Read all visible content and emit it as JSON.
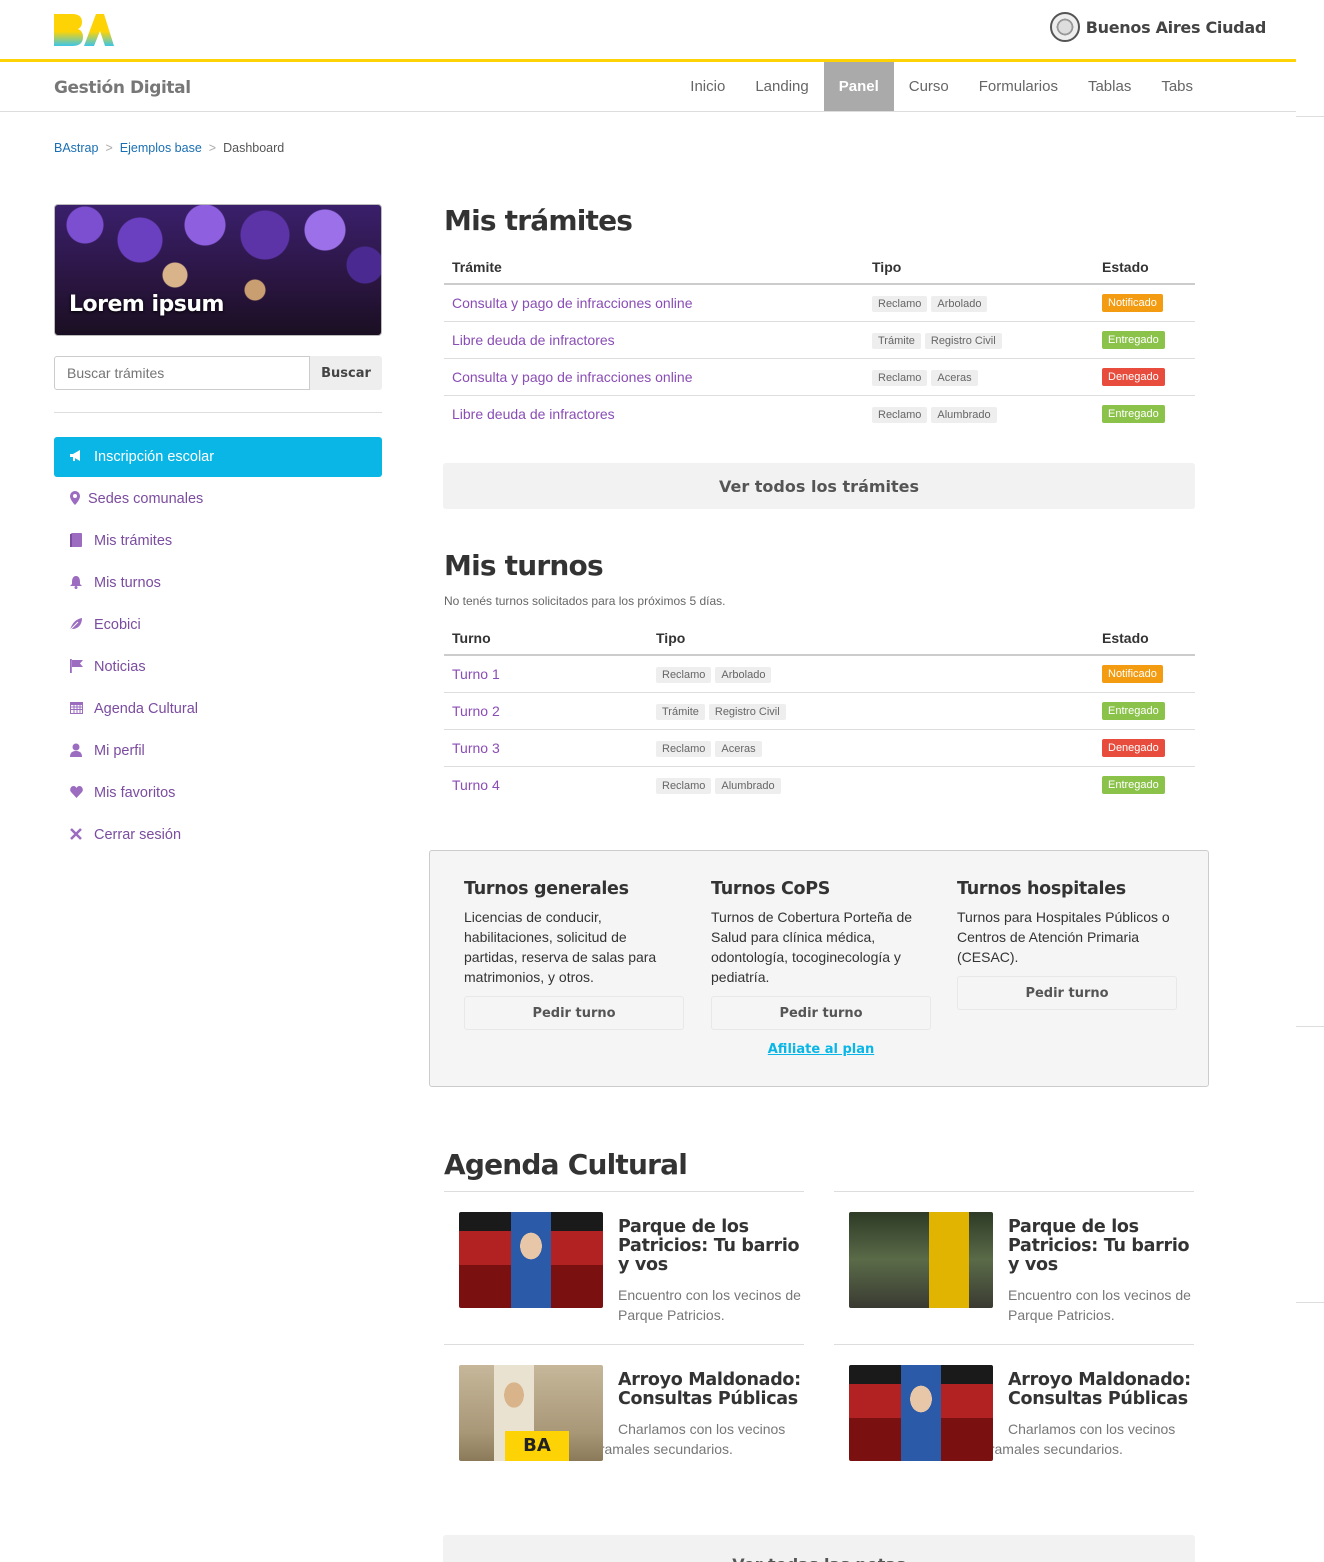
{
  "header": {
    "city_name": "Buenos Aires Ciudad",
    "brand": "Gestión Digital",
    "nav": [
      {
        "label": "Inicio",
        "active": false
      },
      {
        "label": "Landing",
        "active": false
      },
      {
        "label": "Panel",
        "active": true
      },
      {
        "label": "Curso",
        "active": false
      },
      {
        "label": "Formularios",
        "active": false
      },
      {
        "label": "Tablas",
        "active": false
      },
      {
        "label": "Tabs",
        "active": false
      }
    ]
  },
  "breadcrumb": [
    "BAstrap",
    "Ejemplos base",
    "Dashboard"
  ],
  "sidebar": {
    "promo_title": "Lorem ipsum",
    "search_placeholder": "Buscar trámites",
    "search_button": "Buscar",
    "menu": [
      {
        "label": "Inscripción escolar",
        "icon": "megaphone-icon",
        "active": true
      },
      {
        "label": "Sedes comunales",
        "icon": "map-marker-icon"
      },
      {
        "label": "Mis trámites",
        "icon": "book-icon"
      },
      {
        "label": "Mis turnos",
        "icon": "bell-icon"
      },
      {
        "label": "Ecobici",
        "icon": "leaf-icon"
      },
      {
        "label": "Noticias",
        "icon": "flag-icon"
      },
      {
        "label": "Agenda Cultural",
        "icon": "calendar-icon"
      },
      {
        "label": "Mi perfil",
        "icon": "user-icon"
      },
      {
        "label": "Mis favoritos",
        "icon": "heart-icon"
      },
      {
        "label": "Cerrar sesión",
        "icon": "close-icon"
      }
    ]
  },
  "tramites": {
    "title": "Mis trámites",
    "columns": [
      "Trámite",
      "Tipo",
      "Estado"
    ],
    "rows": [
      {
        "name": "Consulta y pago de infracciones online",
        "tags": [
          "Reclamo",
          "Arbolado"
        ],
        "status": "Notificado"
      },
      {
        "name": "Libre deuda de infractores",
        "tags": [
          "Trámite",
          "Registro Civil"
        ],
        "status": "Entregado"
      },
      {
        "name": "Consulta y pago de infracciones online",
        "tags": [
          "Reclamo",
          "Aceras"
        ],
        "status": "Denegado"
      },
      {
        "name": "Libre deuda de infractores",
        "tags": [
          "Reclamo",
          "Alumbrado"
        ],
        "status": "Entregado"
      }
    ],
    "button": "Ver todos los trámites"
  },
  "turnos": {
    "title": "Mis turnos",
    "subtitle": "No tenés turnos solicitados para los próximos 5 días.",
    "columns": [
      "Turno",
      "Tipo",
      "Estado"
    ],
    "rows": [
      {
        "name": "Turno 1",
        "tags": [
          "Reclamo",
          "Arbolado"
        ],
        "status": "Notificado"
      },
      {
        "name": "Turno 2",
        "tags": [
          "Trámite",
          "Registro Civil"
        ],
        "status": "Entregado"
      },
      {
        "name": "Turno 3",
        "tags": [
          "Reclamo",
          "Aceras"
        ],
        "status": "Denegado"
      },
      {
        "name": "Turno 4",
        "tags": [
          "Reclamo",
          "Alumbrado"
        ],
        "status": "Entregado"
      }
    ]
  },
  "turnos_box": [
    {
      "title": "Turnos generales",
      "text": "Licencias de conducir, habilitaciones, solicitud de partidas, reserva de salas para matrimonios, y otros.",
      "button": "Pedir turno",
      "link": ""
    },
    {
      "title": "Turnos CoPS",
      "text": "Turnos de Cobertura Porteña de Salud para clínica médica, odontología, tocoginecología y pediatría.",
      "button": "Pedir turno",
      "link": "Afiliate al plan"
    },
    {
      "title": "Turnos hospitales",
      "text": "Turnos para Hospitales Públicos o Centros de Atención Primaria (CESAC).",
      "button": "Pedir turno",
      "link": ""
    }
  ],
  "agenda": {
    "title": "Agenda Cultural",
    "items": [
      {
        "title": "Parque de los Patricios: Tu barrio y vos",
        "text": "Encuentro con los vecinos de Parque Patricios."
      },
      {
        "title": "Parque de los Patricios: Tu barrio y vos",
        "text": "Encuentro con los vecinos de Parque Patricios."
      },
      {
        "title": "Arroyo Maldonado: Consultas Públicas",
        "text": "Charlamos con los vecinos sobre las obras de los ramales secundarios."
      },
      {
        "title": "Arroyo Maldonado: Consultas Públicas",
        "text": "Charlamos con los vecinos sobre las obras de los ramales secundarios."
      }
    ],
    "image_badge": "BA",
    "button": "Ver todas las notas"
  },
  "colors": {
    "accent_yellow": "#fdd306",
    "accent_cyan": "#0ab6e6",
    "link_purple": "#8a4db5",
    "status_notificado": "#f39c12",
    "status_entregado": "#8bc34a",
    "status_denegado": "#e74c3c"
  }
}
